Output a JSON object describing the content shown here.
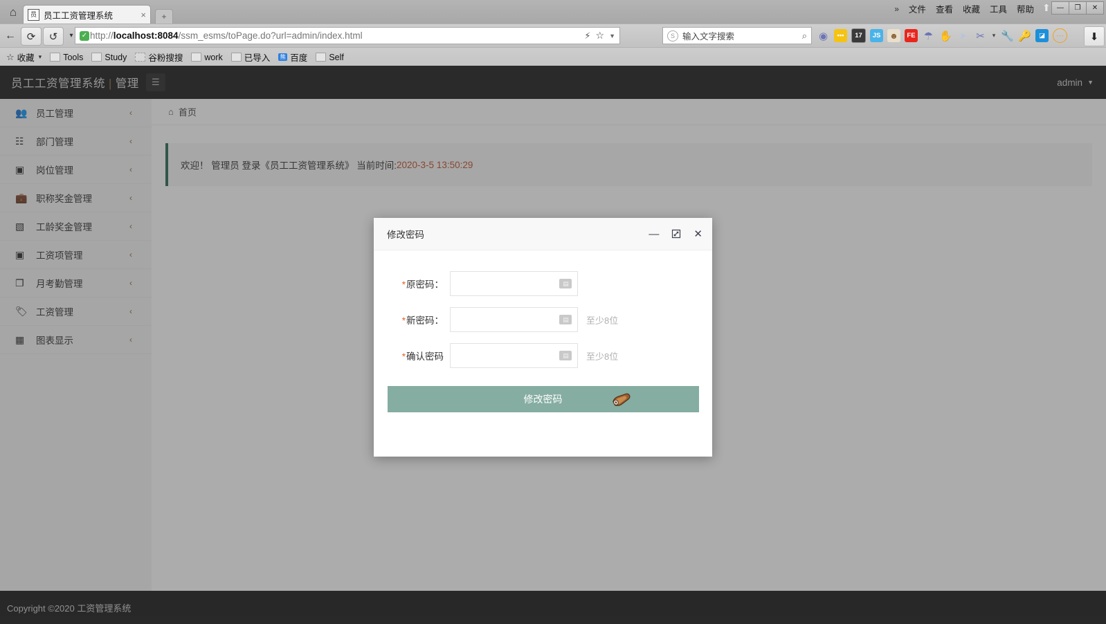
{
  "browser": {
    "home_icon": "home-icon",
    "tab": {
      "favicon": "app-favicon",
      "title": "员工工资管理系统",
      "close": "×"
    },
    "new_tab": "+",
    "window_menu": {
      "overflow": "»",
      "items": [
        "文件",
        "查看",
        "收藏",
        "工具",
        "帮助"
      ]
    },
    "window_buttons": {
      "minimize": "—",
      "maximize": "❐",
      "close": "✕"
    },
    "nav": {
      "back": "←",
      "reload": "⟳",
      "history": "↺",
      "history_caret": "▾"
    },
    "url": {
      "scheme": "http://",
      "host": "localhost:8084",
      "path": "/ssm_esms/toPage.do?url=admin/index.html",
      "shield_icon": "secure-shield-icon"
    },
    "url_right_icons": [
      "lightning-icon",
      "star-icon",
      "chevron-down-icon"
    ],
    "search": {
      "engine_icon": "sogou-icon",
      "placeholder": "输入文字搜索",
      "magnifier": "search-icon"
    },
    "extensions": [
      {
        "name": "opera-icon",
        "glyph": "◉",
        "bg": "none",
        "color": "#7b85c4"
      },
      {
        "name": "dots-yellow-icon",
        "glyph": "•••",
        "bg": "#f5c313",
        "color": "#ffffff"
      },
      {
        "name": "counter-17-icon",
        "glyph": "17",
        "bg": "#3a3a3a",
        "color": "#ffffff"
      },
      {
        "name": "js-icon",
        "glyph": "JS",
        "bg": "#4ab3e8",
        "color": "#ffffff"
      },
      {
        "name": "monkey-icon",
        "glyph": "☻",
        "bg": "#e8e0d0",
        "color": "#8a6233"
      },
      {
        "name": "fe-icon",
        "glyph": "FE",
        "bg": "#e8261d",
        "color": "#ffffff"
      },
      {
        "name": "parachute-icon",
        "glyph": "☂",
        "bg": "none",
        "color": "#6b74b5"
      },
      {
        "name": "hand-icon",
        "glyph": "✋",
        "bg": "none",
        "color": "#5b6bc4"
      },
      {
        "name": "cursor-icon",
        "glyph": "➤",
        "bg": "none",
        "color": "#b9c2de"
      },
      {
        "name": "scissors-icon",
        "glyph": "✂",
        "bg": "none",
        "color": "#6b74b5"
      },
      {
        "name": "scissors-caret-icon",
        "glyph": "▾",
        "bg": "none",
        "color": "#444444"
      },
      {
        "name": "wrench-icon",
        "glyph": "🔧",
        "bg": "none",
        "color": "#6b74b5"
      },
      {
        "name": "key-icon",
        "glyph": "🔑",
        "bg": "none",
        "color": "#f0a01e"
      },
      {
        "name": "screenshot-icon",
        "glyph": "◪",
        "bg": "#1d8fd8",
        "color": "#ffffff"
      },
      {
        "name": "more-icon",
        "glyph": "⋯",
        "bg": "none",
        "color": "#f0a01e"
      }
    ],
    "download_icon": "⬇",
    "bookmarks": [
      {
        "label": "收藏",
        "icon": "star-folder-icon",
        "caret": "▾"
      },
      {
        "label": "Tools",
        "icon": "folder-icon"
      },
      {
        "label": "Study",
        "icon": "folder-icon"
      },
      {
        "label": "谷粉搜搜",
        "icon": "folder-dashed-icon"
      },
      {
        "label": "work",
        "icon": "folder-icon"
      },
      {
        "label": "已导入",
        "icon": "folder-icon"
      },
      {
        "label": "百度",
        "icon": "baidu-icon"
      },
      {
        "label": "Self",
        "icon": "folder-icon"
      }
    ]
  },
  "app": {
    "logo_main": "员工工资管理系统",
    "logo_sep": "|",
    "logo_sub": "管理",
    "burger_icon": "menu-icon",
    "user": {
      "name": "admin",
      "caret": "▼"
    },
    "sidebar": [
      {
        "label": "员工管理",
        "icon": "users-icon",
        "glyph": "👥",
        "chevron": "‹"
      },
      {
        "label": "部门管理",
        "icon": "sitemap-icon",
        "glyph": "⛭",
        "chevron": "‹"
      },
      {
        "label": "岗位管理",
        "icon": "badge-icon",
        "glyph": "▤",
        "chevron": "‹"
      },
      {
        "label": "职称奖金管理",
        "icon": "briefcase-icon",
        "glyph": "💼",
        "chevron": "‹"
      },
      {
        "label": "工龄奖金管理",
        "icon": "cash-icon",
        "glyph": "▰",
        "chevron": "‹"
      },
      {
        "label": "工资项管理",
        "icon": "money-note-icon",
        "glyph": "▣",
        "chevron": "‹"
      },
      {
        "label": "月考勤管理",
        "icon": "layers-icon",
        "glyph": "❐",
        "chevron": "‹"
      },
      {
        "label": "工资管理",
        "icon": "tag-icon",
        "glyph": "🏷",
        "chevron": "‹"
      },
      {
        "label": "图表显示",
        "icon": "chart-icon",
        "glyph": "▥",
        "chevron": "‹"
      }
    ],
    "breadcrumb": {
      "home_icon": "home-icon",
      "label": "首页"
    },
    "welcome": {
      "text": "欢迎！ 管理员 登录《员工工资管理系统》 当前时间:",
      "time": "2020-3-5 13:50:29",
      "accent_color": "#2c6b56",
      "time_color": "#c0512b"
    },
    "footer": "Copyright ©2020 工资管理系统"
  },
  "modal": {
    "title": "修改密码",
    "controls": {
      "minimize": "—",
      "maximize": "⤢",
      "close": "✕"
    },
    "fields": [
      {
        "required": "*",
        "label": "原密码：",
        "value": "",
        "placeholder": "",
        "hint": "",
        "keyboard_icon": "soft-keyboard-icon"
      },
      {
        "required": "*",
        "label": "新密码：",
        "value": "",
        "placeholder": "",
        "hint": "至少8位",
        "keyboard_icon": "soft-keyboard-icon"
      },
      {
        "required": "*",
        "label": "确认密码",
        "value": "",
        "placeholder": "",
        "hint": "至少8位",
        "keyboard_icon": "soft-keyboard-icon"
      }
    ],
    "submit_label": "修改密码",
    "submit_color": "#85ada1"
  },
  "cursor": {
    "name": "hand-pointer-cursor"
  }
}
